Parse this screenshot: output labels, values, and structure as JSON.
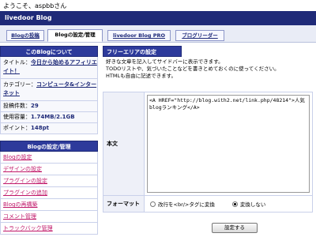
{
  "header": {
    "welcome": "ようこそ、aspbbさん",
    "brand": "livedoor Blog"
  },
  "tabs": [
    {
      "label": "Blogの投稿"
    },
    {
      "label": "Blogの設定/管理"
    },
    {
      "label": "livedoor Blog PRO"
    },
    {
      "label": "ブログリーダー"
    }
  ],
  "about": {
    "title": "このBlogについて",
    "title_label": "タイトル：",
    "title_value": "今日から始めるアフィリエイト！",
    "category_label": "カテゴリー：",
    "category_value": "コンピュータ&インターネット",
    "posts_label": "投稿件数：",
    "posts_value": "29",
    "storage_label": "使用容量：",
    "storage_value": "1.74MB/2.1GB",
    "points_label": "ポイント：",
    "points_value": "148pt"
  },
  "menu": {
    "title": "Blogの設定/管理",
    "items": [
      "Blogの設定",
      "デザインの設定",
      "プラグインの設定",
      "プラグインの追加",
      "Blogの再構築",
      "コメント管理",
      "トラックバック管理"
    ]
  },
  "main": {
    "title": "フリーエリアの設定",
    "desc_1": "好きな文章を記入してサイドバーに表示できます。",
    "desc_2": "TODOリストや、気づいたことなどを書きとめておくのに使ってください。",
    "desc_3": "HTMLも自由に記述できます。",
    "body_label": "本文",
    "body_value": "<A HREF=\"http://blog.with2.net/link.php/48214\">人気blogランキング</A>",
    "format_label": "フォーマット",
    "format_option_1": "改行を<br/>タグに変換",
    "format_option_2": "変換しない",
    "selected_format": "変換しない",
    "submit_label": "設定する"
  }
}
